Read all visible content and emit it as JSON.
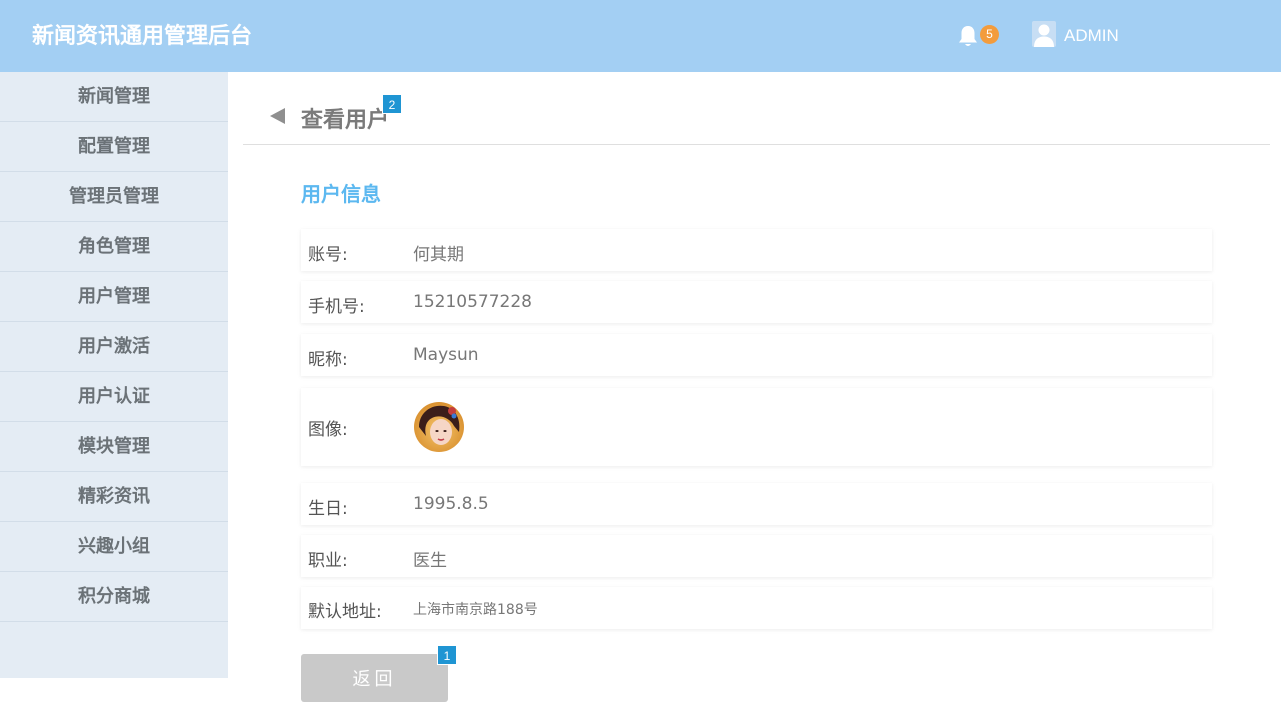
{
  "header": {
    "title": "新闻资讯通用管理后台",
    "notification_count": "5",
    "user_name": "ADMIN",
    "icons": [
      "bell-icon",
      "user-icon"
    ]
  },
  "sidebar": {
    "items": [
      {
        "label": "新闻管理"
      },
      {
        "label": "配置管理"
      },
      {
        "label": "管理员管理"
      },
      {
        "label": "角色管理"
      },
      {
        "label": "用户管理"
      },
      {
        "label": "用户激活"
      },
      {
        "label": "用户认证"
      },
      {
        "label": "模块管理"
      },
      {
        "label": "精彩资讯"
      },
      {
        "label": "兴趣小组"
      },
      {
        "label": "积分商城"
      }
    ]
  },
  "main": {
    "page_title": "查看用户",
    "title_tag": "2",
    "section_title": "用户信息",
    "fields": {
      "account": {
        "label": "账号:",
        "value": "何其期"
      },
      "phone": {
        "label": "手机号:",
        "value": "15210577228"
      },
      "nickname": {
        "label": "昵称:",
        "value": "Maysun"
      },
      "avatar": {
        "label": "图像:"
      },
      "birthday": {
        "label": "生日:",
        "value": "1995.8.5"
      },
      "occupation": {
        "label": "职业:",
        "value": "医生"
      },
      "address": {
        "label": "默认地址:",
        "value": "上海市南京路188号"
      }
    },
    "back_button": {
      "label": "返回",
      "tag": "1"
    }
  },
  "colors": {
    "header_bg": "#a3cff3",
    "sidebar_bg": "#e4ecf4",
    "accent": "#5cb8f0",
    "badge": "#f39c3c",
    "tag": "#1f95d3",
    "button_bg": "#c9c9c9"
  }
}
